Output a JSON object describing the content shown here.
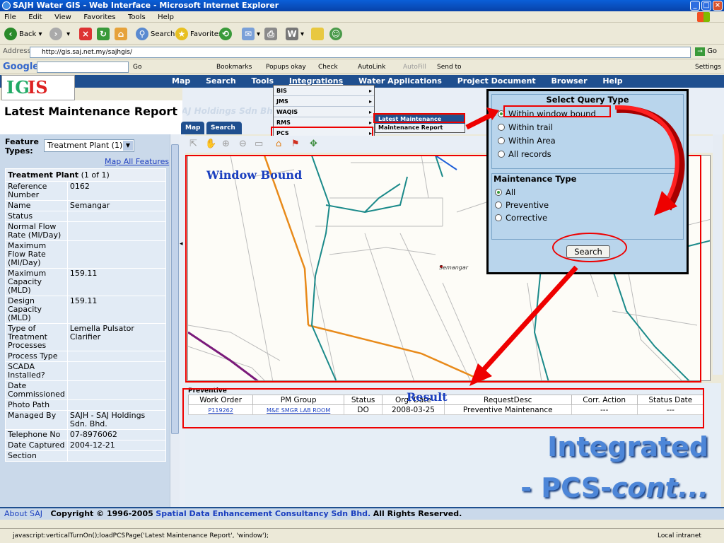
{
  "window": {
    "title": "SAJH Water GIS - Web Interface - Microsoft Internet Explorer"
  },
  "menubar": [
    "File",
    "Edit",
    "View",
    "Favorites",
    "Tools",
    "Help"
  ],
  "toolbar": {
    "back": "Back",
    "search": "Search",
    "favorites": "Favorites"
  },
  "address": {
    "label": "Address",
    "url": "http://gis.saj.net.my/sajhgis/",
    "go": "Go"
  },
  "googlebar": {
    "logo": "Google",
    "go": "Go",
    "bookmarks": "Bookmarks",
    "popups": "Popups okay",
    "check": "Check",
    "autolink": "AutoLink",
    "autofill": "AutoFill",
    "sendto": "Send to",
    "settings": "Settings"
  },
  "app": {
    "logo_part1": "IG",
    "logo_part2": "IS",
    "nav": [
      "Map",
      "Search",
      "Tools",
      "Integrations",
      "Water Applications",
      "Project Document",
      "Browser",
      "Help"
    ],
    "integrations_menu": [
      "BIS",
      "JMS",
      "WAQIS",
      "RMS",
      "PCS"
    ],
    "pcs_submenu": [
      "Latest Maintenance Report",
      "Maintenance Report"
    ],
    "page_title": "Latest Maintenance Report",
    "watermark": "SAJ Holdings Sdn Bhd",
    "tabs": [
      "Map",
      "Search Results"
    ]
  },
  "left_panel": {
    "feature_types_label": "Feature Types:",
    "feature_type_value": "Treatment Plant (1)",
    "map_all": "Map All Features",
    "table_title": "Treatment Plant",
    "table_count": "(1 of 1)",
    "rows": [
      {
        "k": "Reference Number",
        "v": "0162"
      },
      {
        "k": "Name",
        "v": "Semangar"
      },
      {
        "k": "Status",
        "v": ""
      },
      {
        "k": "Normal Flow Rate (Ml/Day)",
        "v": ""
      },
      {
        "k": "Maximum Flow Rate (Ml/Day)",
        "v": ""
      },
      {
        "k": "Maximum Capacity (MLD)",
        "v": "159.11"
      },
      {
        "k": "Design Capacity (MLD)",
        "v": "159.11"
      },
      {
        "k": "Type of Treatment Processes",
        "v": "Lemella Pulsator Clarifier"
      },
      {
        "k": "Process Type",
        "v": ""
      },
      {
        "k": "SCADA Installed?",
        "v": ""
      },
      {
        "k": "Date Commissioned",
        "v": ""
      },
      {
        "k": "Photo Path",
        "v": ""
      },
      {
        "k": "Managed By",
        "v": "SAJH - SAJ Holdings Sdn. Bhd."
      },
      {
        "k": "Telephone No",
        "v": "07-8976062"
      },
      {
        "k": "Date Captured",
        "v": "2004-12-21"
      },
      {
        "k": "Section",
        "v": ""
      }
    ]
  },
  "map": {
    "annotation": "Window Bound",
    "site_label": "Semangar"
  },
  "query_panel": {
    "title": "Select Query Type",
    "query_options": [
      "Within window bound",
      "Within trail",
      "Within Area",
      "All records"
    ],
    "selected_query": "Within window bound",
    "maintenance_title": "Maintenance Type",
    "maintenance_options": [
      "All",
      "Preventive",
      "Corrective"
    ],
    "selected_maintenance": "All",
    "search_button": "Search"
  },
  "results": {
    "group_label": "Preventive",
    "annotation": "Result",
    "columns": [
      "Work Order",
      "PM Group",
      "Status",
      "Org. Date",
      "RequestDesc",
      "Corr. Action",
      "Status Date"
    ],
    "rows": [
      [
        "P119262",
        "M&E SMGR LAB ROOM",
        "DO",
        "2008-03-25",
        "Preventive Maintenance",
        "---",
        "---"
      ]
    ]
  },
  "slide": {
    "line1": "Integrated",
    "line2_a": "- PCS-",
    "line2_b": "cont..."
  },
  "footer": {
    "about": "About SAJ",
    "copyright": "Copyright © 1996-2005",
    "company": "Spatial Data Enhancement Consultancy Sdn Bhd.",
    "rights": "All Rights Reserved."
  },
  "statusbar": {
    "text": "javascript:verticalTurnOn();loadPCSPage('Latest Maintenance Report', 'window');",
    "zone": "Local intranet"
  },
  "colors": {
    "header_blue": "#1f4f8f",
    "panel_blue": "#b9d5ec",
    "annotation_red": "#e00000",
    "annotation_blue": "#1a3fbf",
    "map_orange": "#e88a1a",
    "map_teal": "#1b8a8a",
    "map_purple": "#7a1a7a"
  }
}
